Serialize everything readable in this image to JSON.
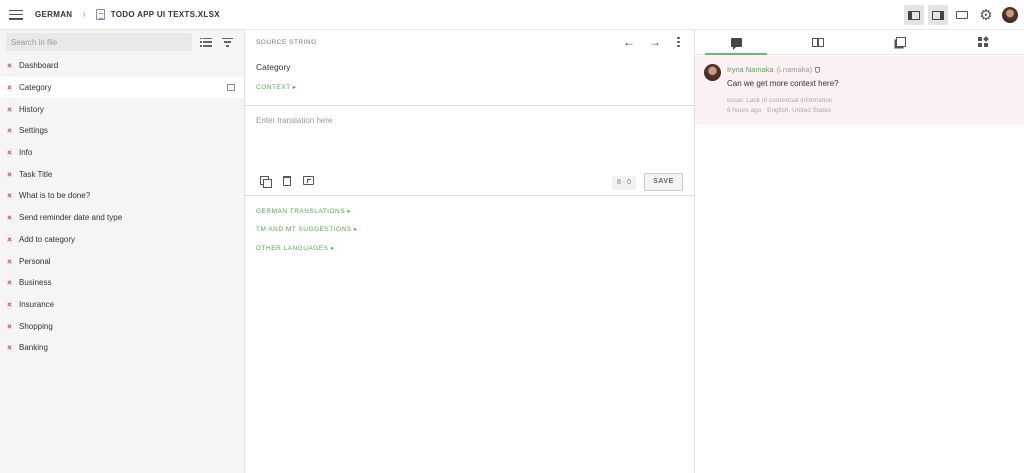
{
  "header": {
    "language": "GERMAN",
    "file_name": "TODO APP UI TEXTS.XLSX"
  },
  "sidebar": {
    "search_placeholder": "Search in file",
    "items": [
      {
        "label": "Dashboard"
      },
      {
        "label": "Category",
        "active": true
      },
      {
        "label": "History"
      },
      {
        "label": "Settings"
      },
      {
        "label": "Info"
      },
      {
        "label": "Task Title"
      },
      {
        "label": "What is to be done?"
      },
      {
        "label": "Send reminder date and type"
      },
      {
        "label": "Add to category"
      },
      {
        "label": "Personal"
      },
      {
        "label": "Business"
      },
      {
        "label": "Insurance"
      },
      {
        "label": "Shopping"
      },
      {
        "label": "Banking"
      }
    ]
  },
  "editor": {
    "source_label": "SOURCE STRING",
    "source_text": "Category",
    "context_link": "CONTEXT",
    "translation_placeholder": "Enter translation here",
    "counter": "8 · 0",
    "save_label": "SAVE",
    "sections": [
      {
        "label": "GERMAN TRANSLATIONS"
      },
      {
        "label": "TM AND MT SUGGESTIONS"
      },
      {
        "label": "OTHER LANGUAGES"
      }
    ]
  },
  "comments": [
    {
      "author": "Iryna Namaka",
      "username": "(i.namaka)",
      "text": "Can we get more context here?",
      "issue": "Issue: Lack of contextual information",
      "meta": "6 hours ago · English, United States"
    }
  ],
  "colors": {
    "accent_green": "#5aa55a",
    "status_red": "#d94a5c",
    "comment_bg": "#fbf1f2"
  }
}
